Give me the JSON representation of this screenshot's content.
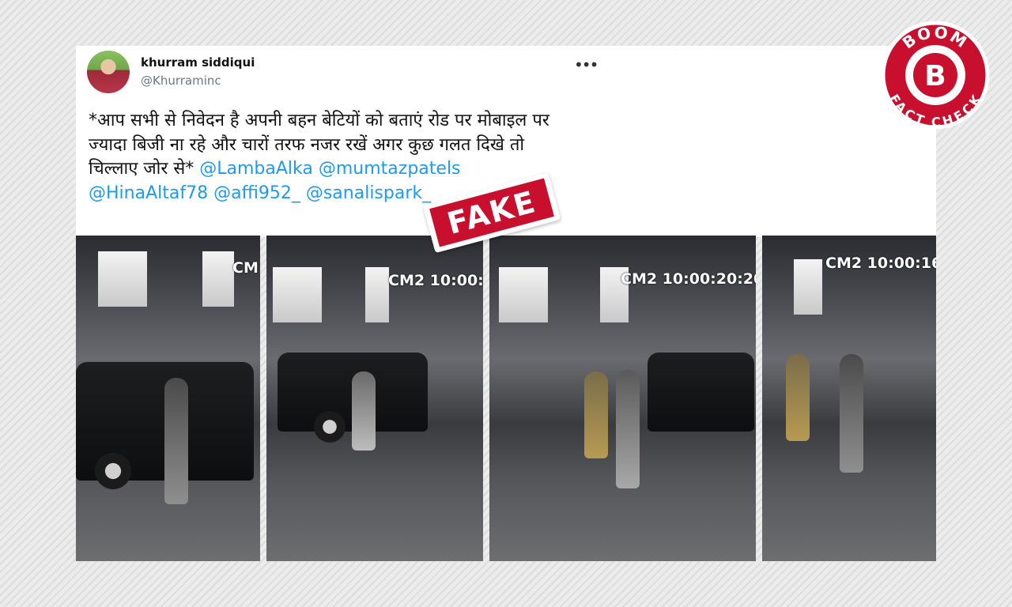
{
  "tweet": {
    "display_name": "khurram siddiqui",
    "handle": "@Khurraminc",
    "more_icon": "more-horizontal-icon",
    "text": "*आप सभी से निवेदन है अपनी बहन बेटियों को बताएं रोड पर मोबाइल पर ज्यादा बिजी ना रहे और चारों तरफ नजर रखें अगर कुछ गलत दिखे तो चिल्लाए जोर से*",
    "mentions": [
      "@LambaAlka",
      "@mumtazpatels",
      "@HinaAltaf78",
      "@affi952_",
      "@sanalispark_"
    ]
  },
  "video_frames": [
    {
      "timestamp": "CM"
    },
    {
      "timestamp": "CM2 10:00:2"
    },
    {
      "timestamp": "CM2 10:00:20:20"
    },
    {
      "timestamp": "CM2 10:00:16:"
    }
  ],
  "stamp": {
    "label": "FAKE"
  },
  "badge": {
    "top_text": "BOOM",
    "letter": "B",
    "bottom_text": "FACT CHECK"
  },
  "colors": {
    "brand_red": "#c8102e",
    "mention_blue": "#1d9bf0",
    "handle_gray": "#6b7880"
  }
}
